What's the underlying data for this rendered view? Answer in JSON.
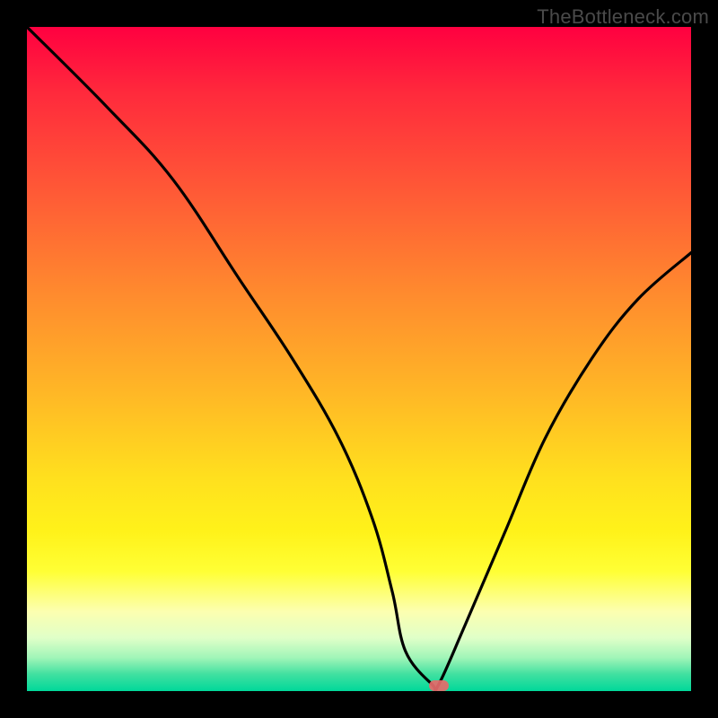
{
  "attribution": "TheBottleneck.com",
  "colors": {
    "bg": "#000000",
    "gradient_top": "#ff0040",
    "gradient_bottom": "#00d89a",
    "curve": "#000000",
    "marker": "#e66a6a"
  },
  "chart_data": {
    "type": "line",
    "title": "",
    "xlabel": "",
    "ylabel": "",
    "xlim": [
      0,
      100
    ],
    "ylim": [
      0,
      100
    ],
    "series": [
      {
        "name": "bottleneck-curve",
        "x": [
          0,
          12,
          22,
          32,
          40,
          47,
          52,
          55,
          57,
          61,
          62,
          66,
          72,
          78,
          85,
          92,
          100
        ],
        "values": [
          100,
          88,
          77,
          62,
          50,
          38,
          26,
          15,
          6,
          1,
          1,
          10,
          24,
          38,
          50,
          59,
          66
        ]
      }
    ],
    "marker": {
      "x": 62,
      "y": 0.8
    }
  }
}
